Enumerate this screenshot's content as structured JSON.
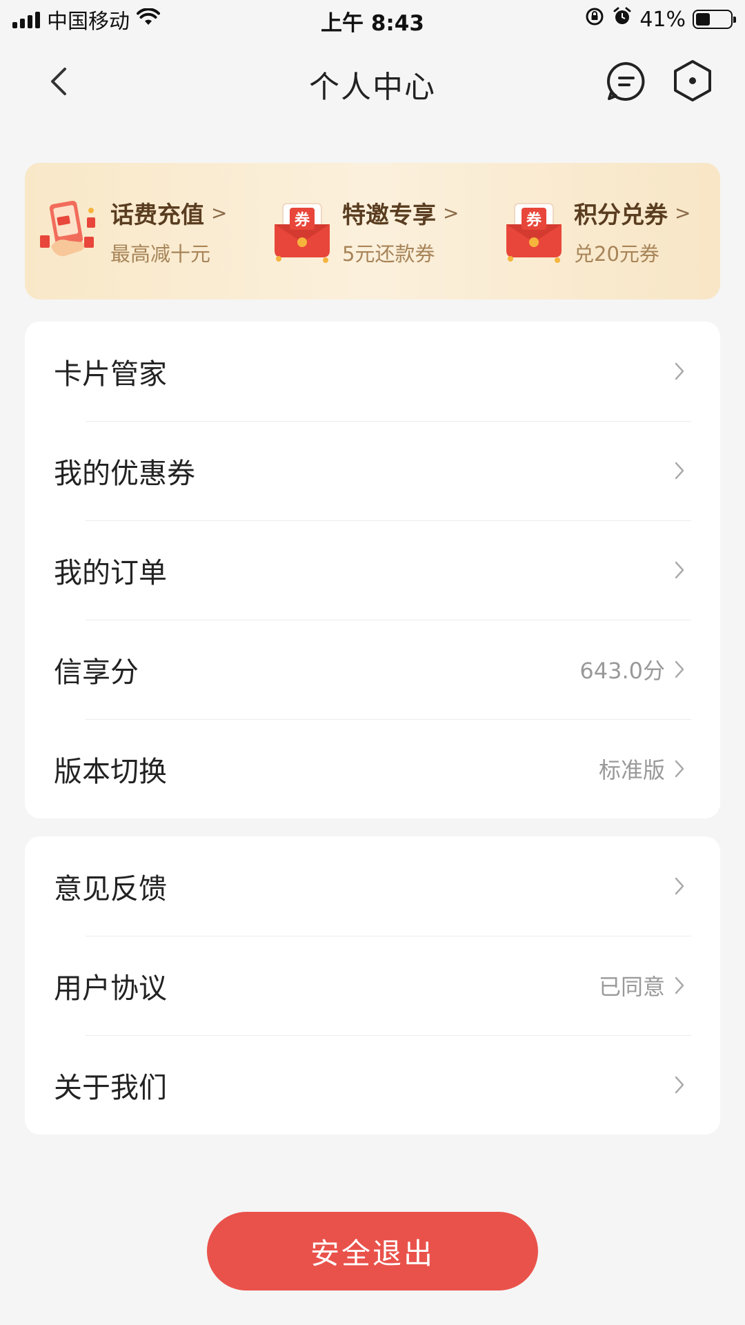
{
  "status_bar": {
    "carrier": "中国移动",
    "time": "上午 8:43",
    "battery_percent": "41%",
    "battery_level": 0.41
  },
  "header": {
    "title": "个人中心",
    "icons": [
      "back-arrow-icon",
      "message-icon",
      "settings-hexagon-icon"
    ]
  },
  "promo": {
    "items": [
      {
        "title": "话费充值",
        "subtitle": "最高减十元",
        "icon": "phone-recharge-icon"
      },
      {
        "title": "特邀专享",
        "subtitle": "5元还款券",
        "icon": "coupon-envelope-icon"
      },
      {
        "title": "积分兑券",
        "subtitle": "兑20元券",
        "icon": "coupon-envelope-icon"
      }
    ],
    "coupon_glyph": "券",
    "chevron": ">"
  },
  "menu_group_1": [
    {
      "label": "卡片管家",
      "value": ""
    },
    {
      "label": "我的优惠券",
      "value": ""
    },
    {
      "label": "我的订单",
      "value": ""
    },
    {
      "label": "信享分",
      "value": "643.0分"
    },
    {
      "label": "版本切换",
      "value": "标准版"
    }
  ],
  "menu_group_2": [
    {
      "label": "意见反馈",
      "value": ""
    },
    {
      "label": "用户协议",
      "value": "已同意"
    },
    {
      "label": "关于我们",
      "value": ""
    }
  ],
  "logout_label": "安全退出",
  "colors": {
    "accent_red": "#e9524b",
    "promo_bg": "#f9e8c8",
    "page_bg": "#f5f5f5"
  }
}
